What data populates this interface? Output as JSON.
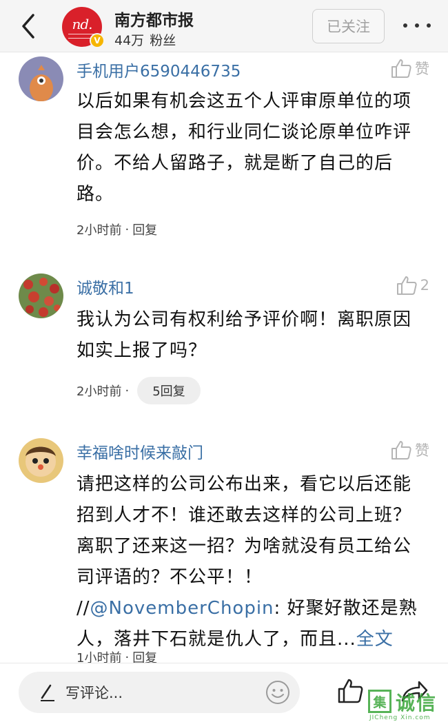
{
  "header": {
    "brand_name": "南方都市报",
    "fans_count": "44万",
    "fans_label": "粉丝",
    "follow_label": "已关注",
    "logo_mark": "nd.",
    "verified_mark": "V"
  },
  "comments": [
    {
      "user": "手机用户6590446735",
      "like_label": "赞",
      "text": "以后如果有机会这五个人评审原单位的项目会怎么想，和行业同仁谈论原单位咋评价。不给人留路子，就是断了自己的后路。",
      "time": "2小时前",
      "separator": "·",
      "reply": "回复"
    },
    {
      "user": "诚敬和1",
      "like_label": "2",
      "text": "我认为公司有权利给予评价啊！离职原因如实上报了吗？",
      "time": "2小时前",
      "separator": "·",
      "reply": "5回复"
    },
    {
      "user": "幸福啥时候来敲门",
      "like_label": "赞",
      "text": "请把这样的公司公布出来，看它以后还能招到人才不！谁还敢去这样的公司上班？离职了还来这一招？为啥就没有员工给公司评语的？不公平！！ //",
      "mention": "@NovemberChopin",
      "text_after": ": 好聚好散还是熟人，落井下石就是仇人了，而且...",
      "fulltext_label": "全文",
      "time": "1小时前",
      "separator": "·",
      "reply": "回复"
    }
  ],
  "bottom_bar": {
    "comment_placeholder": "写评论..."
  },
  "watermark": {
    "box_char": "集",
    "text": "诚信",
    "url": "JICheng Xin.com"
  },
  "colors": {
    "username": "#3a6fa5",
    "brand_red": "#d9202a",
    "verified_gold": "#f6b500"
  }
}
